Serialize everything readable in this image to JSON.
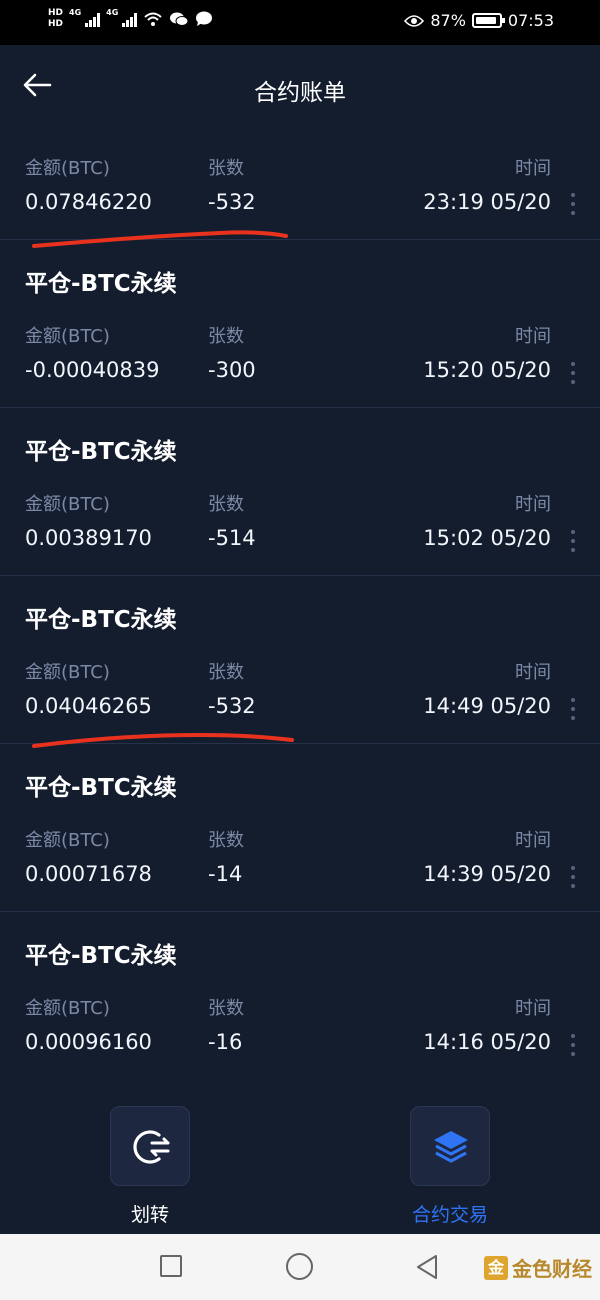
{
  "status_bar": {
    "hd1": "HD",
    "hd2": "HD",
    "net1": "4G",
    "net2": "4G",
    "battery_percent": "87%",
    "time": "07:53"
  },
  "header": {
    "title": "合约账单"
  },
  "labels": {
    "amount": "金额(BTC)",
    "count": "张数",
    "time": "时间"
  },
  "records": [
    {
      "title": "",
      "amount": "0.07846220",
      "count": "-532",
      "time": "23:19 05/20"
    },
    {
      "title": "平仓-BTC永续",
      "amount": "-0.00040839",
      "count": "-300",
      "time": "15:20 05/20"
    },
    {
      "title": "平仓-BTC永续",
      "amount": "0.00389170",
      "count": "-514",
      "time": "15:02 05/20"
    },
    {
      "title": "平仓-BTC永续",
      "amount": "0.04046265",
      "count": "-532",
      "time": "14:49 05/20"
    },
    {
      "title": "平仓-BTC永续",
      "amount": "0.00071678",
      "count": "-14",
      "time": "14:39 05/20"
    },
    {
      "title": "平仓-BTC永续",
      "amount": "0.00096160",
      "count": "-16",
      "time": "14:16 05/20"
    }
  ],
  "bottom_actions": {
    "transfer_label": "划转",
    "contract_trade_label": "合约交易",
    "active_color": "#2f74f5",
    "inactive_color": "#ffffff"
  },
  "watermark": {
    "logo_char": "金",
    "text": "金色财经"
  },
  "colors": {
    "background": "#141d2e",
    "annotation_red": "#e8321e"
  }
}
